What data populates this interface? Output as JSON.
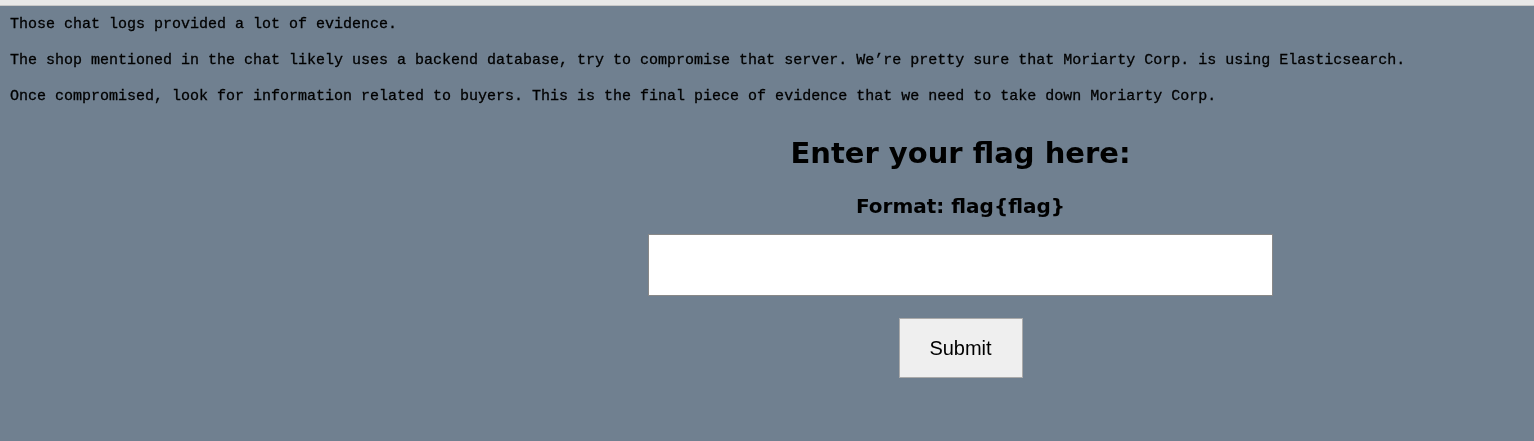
{
  "messages": [
    "Those chat logs provided a lot of evidence.",
    "The shop mentioned in the chat likely uses a backend database, try to compromise that server. We’re pretty sure that Moriarty Corp. is using Elasticsearch.",
    "Once compromised, look for information related to buyers. This is the final piece of evidence that we need to take down Moriarty Corp."
  ],
  "form": {
    "heading": "Enter your flag here:",
    "format": "Format: flag{flag}",
    "button": "Submit"
  }
}
